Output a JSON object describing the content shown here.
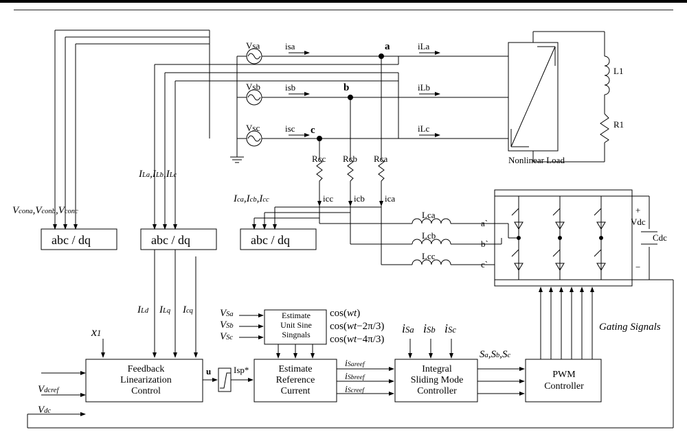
{
  "sources": {
    "a": "Vsa",
    "b": "Vsb",
    "c": "Vsc"
  },
  "src_currents": {
    "a": "isa",
    "b": "isb",
    "c": "isc"
  },
  "load_currents": {
    "a": "iLa",
    "b": "iLb",
    "c": "iLc"
  },
  "nodes": {
    "a": "a",
    "b": "b",
    "c": "c"
  },
  "nonlinear_load": "Nonlinear  Load",
  "load_elem": {
    "L": "L1",
    "R": "R1"
  },
  "comp_res": {
    "a": "Rca",
    "b": "Rcb",
    "c": "Rcc"
  },
  "comp_curr": {
    "a": "ica",
    "b": "icb",
    "c": "icc"
  },
  "comp_ind": {
    "a": "Lca",
    "b": "Lcb",
    "c": "Lcc"
  },
  "inverter_nodes": {
    "a": "a`",
    "b": "b`",
    "c": "c`"
  },
  "dc": {
    "v": "Vdc",
    "c": "Cdc"
  },
  "abc_dq": "abc / dq",
  "tap_labels": {
    "Vcon": "V<sub>cona</sub>,V<sub>conb</sub>,V<sub>conc</sub>",
    "IL": "I<sub>La</sub>,I<sub>Lb</sub>,I<sub>Lc</sub>",
    "Ic": "I<sub>ca</sub>,I<sub>cb</sub>,I<sub>cc</sub>",
    "ILdq": "I<sub>Ld</sub>",
    "ILq_cq": "I<sub>Lq</sub>",
    "Icq": "I<sub>cq</sub>"
  },
  "sig_x1": "x<sub>1</sub>",
  "sig_vdcref": "V<sub>dcref</sub>",
  "sig_vdc": "V<sub>dc</sub>",
  "block_flc": "Feedback Linearization Control",
  "out_u": "u",
  "out_isp": "Isp*",
  "Vs_in": {
    "a": "V<sub>Sa</sub>",
    "b": "V<sub>Sb</sub>",
    "c": "V<sub>Sc</sub>"
  },
  "block_sine": "Estimate Unit Sine Singnals",
  "cos": {
    "a": "cos(wt)",
    "b": "cos(wt−2π/3)",
    "c": "cos(wt−4π/3)"
  },
  "block_ref": "Estimate Reference Current",
  "iref": {
    "a": "i<sub>Sareef</sub>",
    "b": "i<sub>Sbreef</sub>",
    "c": "i<sub>Screef</sub>"
  },
  "iS": {
    "a": "i<sub>Sa</sub>",
    "b": "i<sub>Sb</sub>",
    "c": "i<sub>Sc</sub>"
  },
  "block_ismc": "Integral Sliding Mode Controller",
  "Sabc": "S<sub>a</sub>,S<sub>b</sub>,S<sub>c</sub>",
  "block_pwm": "PWM Controller",
  "gating": "Gating Signals"
}
